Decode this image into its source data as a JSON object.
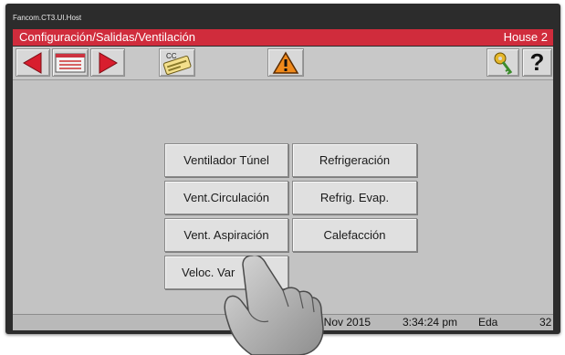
{
  "window": {
    "host_title": "Fancom.CT3.UI.Host"
  },
  "titlebar": {
    "path": "Configuración/Salidas/Ventilación",
    "house": "House 2"
  },
  "toolbar": {
    "cc_label": "CC",
    "help_label": "?",
    "icons": [
      "arrow-left-icon",
      "list-icon",
      "arrow-right-icon",
      "card-icon",
      "warning-icon",
      "key-icon",
      "help-icon"
    ]
  },
  "menu": {
    "ventilador_tunel": "Ventilador Túnel",
    "refrigeracion": "Refrigeración",
    "vent_circulacion": "Vent.Circulación",
    "refrig_evap": "Refrig. Evap.",
    "vent_aspiracion": "Vent. Aspiración",
    "calefaccion": "Calefacción",
    "veloc_var": "Veloc. Var"
  },
  "status": {
    "date": "19 Nov 2015",
    "time": "3:34:24 pm",
    "day": "Eda",
    "count": "32"
  },
  "colors": {
    "title_red": "#d02c3c",
    "arrow_red": "#d81e2e",
    "warning_orange": "#f08a1c",
    "panel_gray": "#c3c3c3"
  }
}
